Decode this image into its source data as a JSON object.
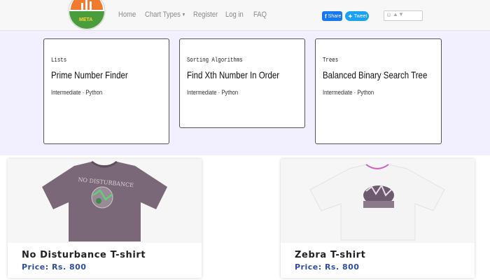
{
  "nav": {
    "logo_text": "META",
    "links": [
      "Home",
      "Chart Types",
      "Register",
      "Log in",
      "FAQ"
    ],
    "share_label": "Share",
    "tweet_label": "Tweet",
    "brand_colors": {
      "facebook": "#1877f2",
      "twitter": "#1da1f2"
    }
  },
  "cards": [
    {
      "category": "Lists",
      "title": "Prime Number Finder",
      "meta": "Intermediate · Python"
    },
    {
      "category": "Sorting Algorithms",
      "title": "Find Xth Number In Order",
      "meta": "Intermediate · Python"
    },
    {
      "category": "Trees",
      "title": "Balanced Binary Search Tree",
      "meta": "Intermediate · Python"
    }
  ],
  "products": [
    {
      "name": "No Disturbance T-shirt",
      "price": "Price: Rs. 800",
      "shirt_color": "#7a6878",
      "print_text": "NO DISTURBANCE"
    },
    {
      "name": "Zebra T-shirt",
      "price": "Price: Rs. 800",
      "shirt_color": "#f4f4f4"
    }
  ],
  "colors": {
    "band_bg": "#f2f0fe",
    "price_text": "#2d4ea3"
  }
}
